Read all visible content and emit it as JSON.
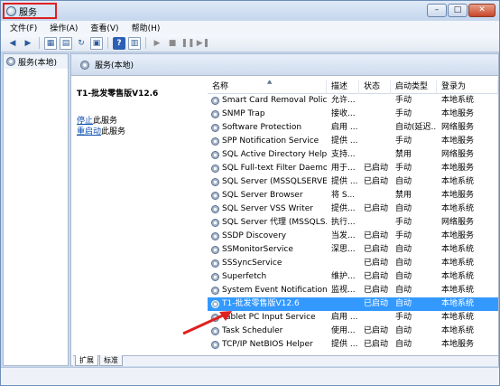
{
  "window": {
    "title": "服务",
    "controls": [
      "–",
      "□",
      "✕"
    ]
  },
  "menu": [
    "文件(F)",
    "操作(A)",
    "查看(V)",
    "帮助(H)"
  ],
  "left_pane": {
    "item": "服务(本地)"
  },
  "right_pane": {
    "header": "服务(本地)",
    "detail": {
      "title": "T1-批发零售版V12.6",
      "stop_link": "停止",
      "stop_suffix": "此服务",
      "restart_link": "重启动",
      "restart_suffix": "此服务"
    }
  },
  "table": {
    "columns": [
      "名称",
      "描述",
      "状态",
      "启动类型",
      "登录为"
    ],
    "rows": [
      [
        "Smart Card Removal Policy",
        "允许...",
        "",
        "手动",
        "本地系统"
      ],
      [
        "SNMP Trap",
        "接收...",
        "",
        "手动",
        "本地服务"
      ],
      [
        "Software Protection",
        "启用 ...",
        "",
        "自动(延迟...",
        "网络服务"
      ],
      [
        "SPP Notification Service",
        "提供 ...",
        "",
        "手动",
        "本地服务"
      ],
      [
        "SQL Active Directory Help...",
        "支持...",
        "",
        "禁用",
        "网络服务"
      ],
      [
        "SQL Full-text Filter Daemo...",
        "用于...",
        "已启动",
        "手动",
        "本地服务"
      ],
      [
        "SQL Server (MSSQLSERVER)",
        "提供 ...",
        "已启动",
        "自动",
        "本地系统"
      ],
      [
        "SQL Server Browser",
        "将 S...",
        "",
        "禁用",
        "本地服务"
      ],
      [
        "SQL Server VSS Writer",
        "提供...",
        "已启动",
        "自动",
        "本地系统"
      ],
      [
        "SQL Server 代理 (MSSQLS...",
        "执行...",
        "",
        "手动",
        "网络服务"
      ],
      [
        "SSDP Discovery",
        "当发...",
        "已启动",
        "手动",
        "本地服务"
      ],
      [
        "SSMonitorService",
        "深思...",
        "已启动",
        "自动",
        "本地系统"
      ],
      [
        "SSSyncService",
        "",
        "已启动",
        "自动",
        "本地系统"
      ],
      [
        "Superfetch",
        "维护...",
        "已启动",
        "自动",
        "本地系统"
      ],
      [
        "System Event Notification ...",
        "监视...",
        "已启动",
        "自动",
        "本地系统"
      ],
      [
        "T1-批发零售版V12.6",
        "",
        "已启动",
        "自动",
        "本地系统"
      ],
      [
        "Tablet PC Input Service",
        "启用 ...",
        "",
        "手动",
        "本地系统"
      ],
      [
        "Task Scheduler",
        "使用...",
        "已启动",
        "自动",
        "本地系统"
      ],
      [
        "TCP/IP NetBIOS Helper",
        "提供 ...",
        "已启动",
        "自动",
        "本地服务"
      ]
    ],
    "selected_index": 15
  },
  "tabs": [
    "扩展",
    "标准"
  ],
  "colors": {
    "selection": "#3399ff",
    "annotation_arrow": "#e02020",
    "title_highlight": "#e02020"
  }
}
